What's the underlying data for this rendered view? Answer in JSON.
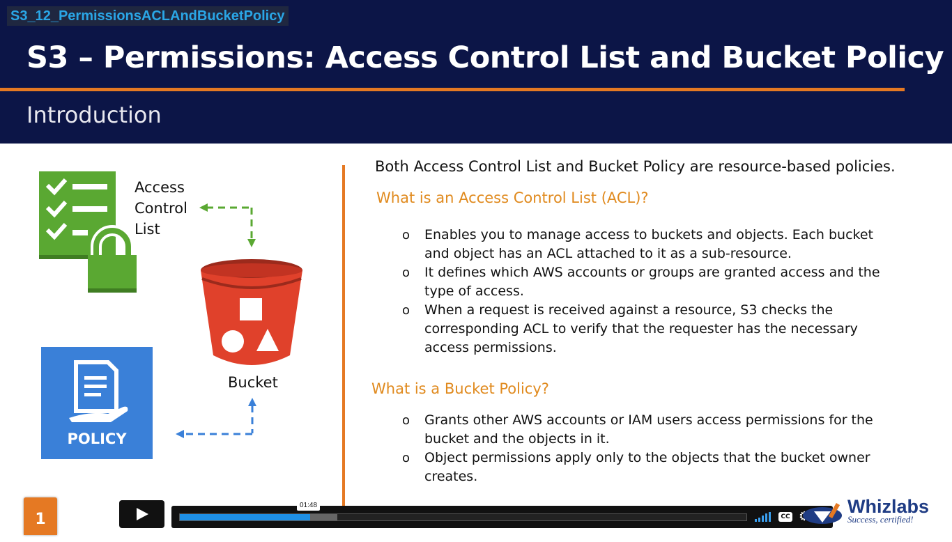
{
  "video": {
    "title": "S3_12_PermissionsACLAndBucketPolicy"
  },
  "slide": {
    "title": "S3 – Permissions: Access Control List and Bucket Policy",
    "subtitle": "Introduction",
    "number": "1",
    "diagram": {
      "acl_label_lines": [
        "Access",
        "Control",
        "List"
      ],
      "bucket_label": "Bucket",
      "policy_label": "POLICY"
    },
    "intro": "Both Access Control List and Bucket Policy are resource-based policies.",
    "acl_section": {
      "heading": "What is an Access Control List (ACL)?",
      "bullets": [
        "Enables you to manage access to buckets and objects. Each bucket and object has an ACL attached to it as a sub-resource.",
        "It defines which AWS accounts or groups are granted access and the type of access.",
        "When a request is received against a resource, S3 checks the corresponding ACL to verify that the requester has the necessary access permissions."
      ]
    },
    "policy_section": {
      "heading": "What is a Bucket Policy?",
      "bullets": [
        "Grants other AWS accounts or IAM users access permissions for the bucket and the objects in it.",
        "Object permissions apply only to the objects that the bucket owner creates."
      ]
    },
    "bullet_glyph": "o"
  },
  "player": {
    "current_time": "01:48",
    "progress": 0.23,
    "buffered": 0.278,
    "cc_label": "CC",
    "icons": [
      "play-icon",
      "volume-icon",
      "cc-icon",
      "gear-icon",
      "fullscreen-icon"
    ]
  },
  "branding": {
    "logo_text": "Whizlabs",
    "tagline": "Success, certified!"
  },
  "colors": {
    "header_bg": "#0c1547",
    "accent_orange": "#e57923",
    "heading_orange": "#e08a1e",
    "progress_blue": "#1e90e6",
    "acl_green": "#5aa832",
    "bucket_red": "#e0412b",
    "policy_blue": "#3a80d8"
  }
}
